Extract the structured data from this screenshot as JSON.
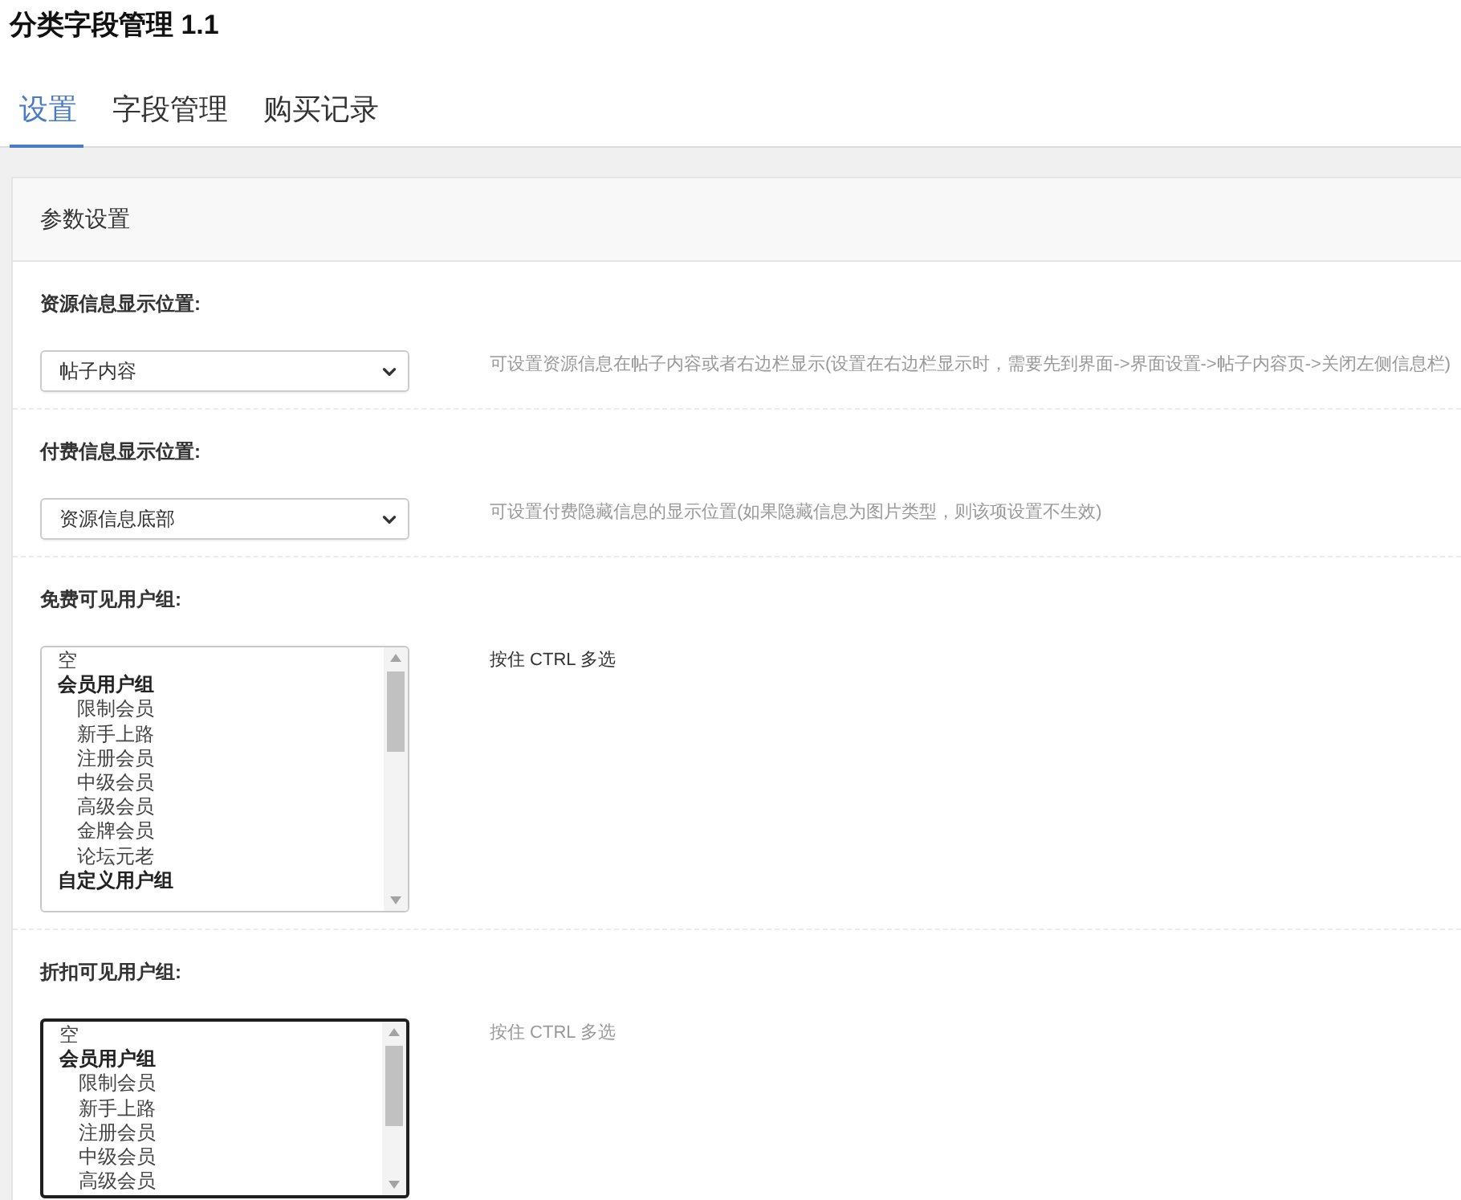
{
  "title": "分类字段管理 1.1",
  "tabs": [
    {
      "label": "设置",
      "selected": true
    },
    {
      "label": "字段管理",
      "selected": false
    },
    {
      "label": "购买记录",
      "selected": false
    }
  ],
  "panel": {
    "title": "参数设置",
    "settings": [
      {
        "kind": "select",
        "label": "资源信息显示位置:",
        "value": "帖子内容",
        "hint": "可设置资源信息在帖子内容或者右边栏显示(设置在右边栏显示时，需要先到界面->界面设置->帖子内容页->关闭左侧信息栏)",
        "hovered": false
      },
      {
        "kind": "select",
        "label": "付费信息显示位置:",
        "value": "资源信息底部",
        "hint": "可设置付费隐藏信息的显示位置(如果隐藏信息为图片类型，则该项设置不生效)",
        "hovered": false
      },
      {
        "kind": "listbox",
        "label": "免费可见用户组:",
        "focused": false,
        "options": [
          {
            "kind": "option",
            "label": "空"
          },
          {
            "kind": "group",
            "label": "会员用户组",
            "children": [
              {
                "label": "限制会员"
              },
              {
                "label": "新手上路"
              },
              {
                "label": "注册会员"
              },
              {
                "label": "中级会员"
              },
              {
                "label": "高级会员"
              },
              {
                "label": "金牌会员"
              },
              {
                "label": "论坛元老"
              }
            ]
          },
          {
            "kind": "group",
            "label": "自定义用户组"
          }
        ],
        "hint": "按住 CTRL 多选",
        "hovered": true
      },
      {
        "kind": "listbox",
        "label": "折扣可见用户组:",
        "focused": true,
        "options": [
          {
            "kind": "option",
            "label": "空"
          },
          {
            "kind": "group",
            "label": "会员用户组",
            "children": [
              {
                "label": "限制会员"
              },
              {
                "label": "新手上路"
              },
              {
                "label": "注册会员"
              },
              {
                "label": "中级会员"
              },
              {
                "label": "高级会员"
              }
            ]
          }
        ],
        "hint": "按住 CTRL 多选",
        "hovered": false
      }
    ]
  }
}
